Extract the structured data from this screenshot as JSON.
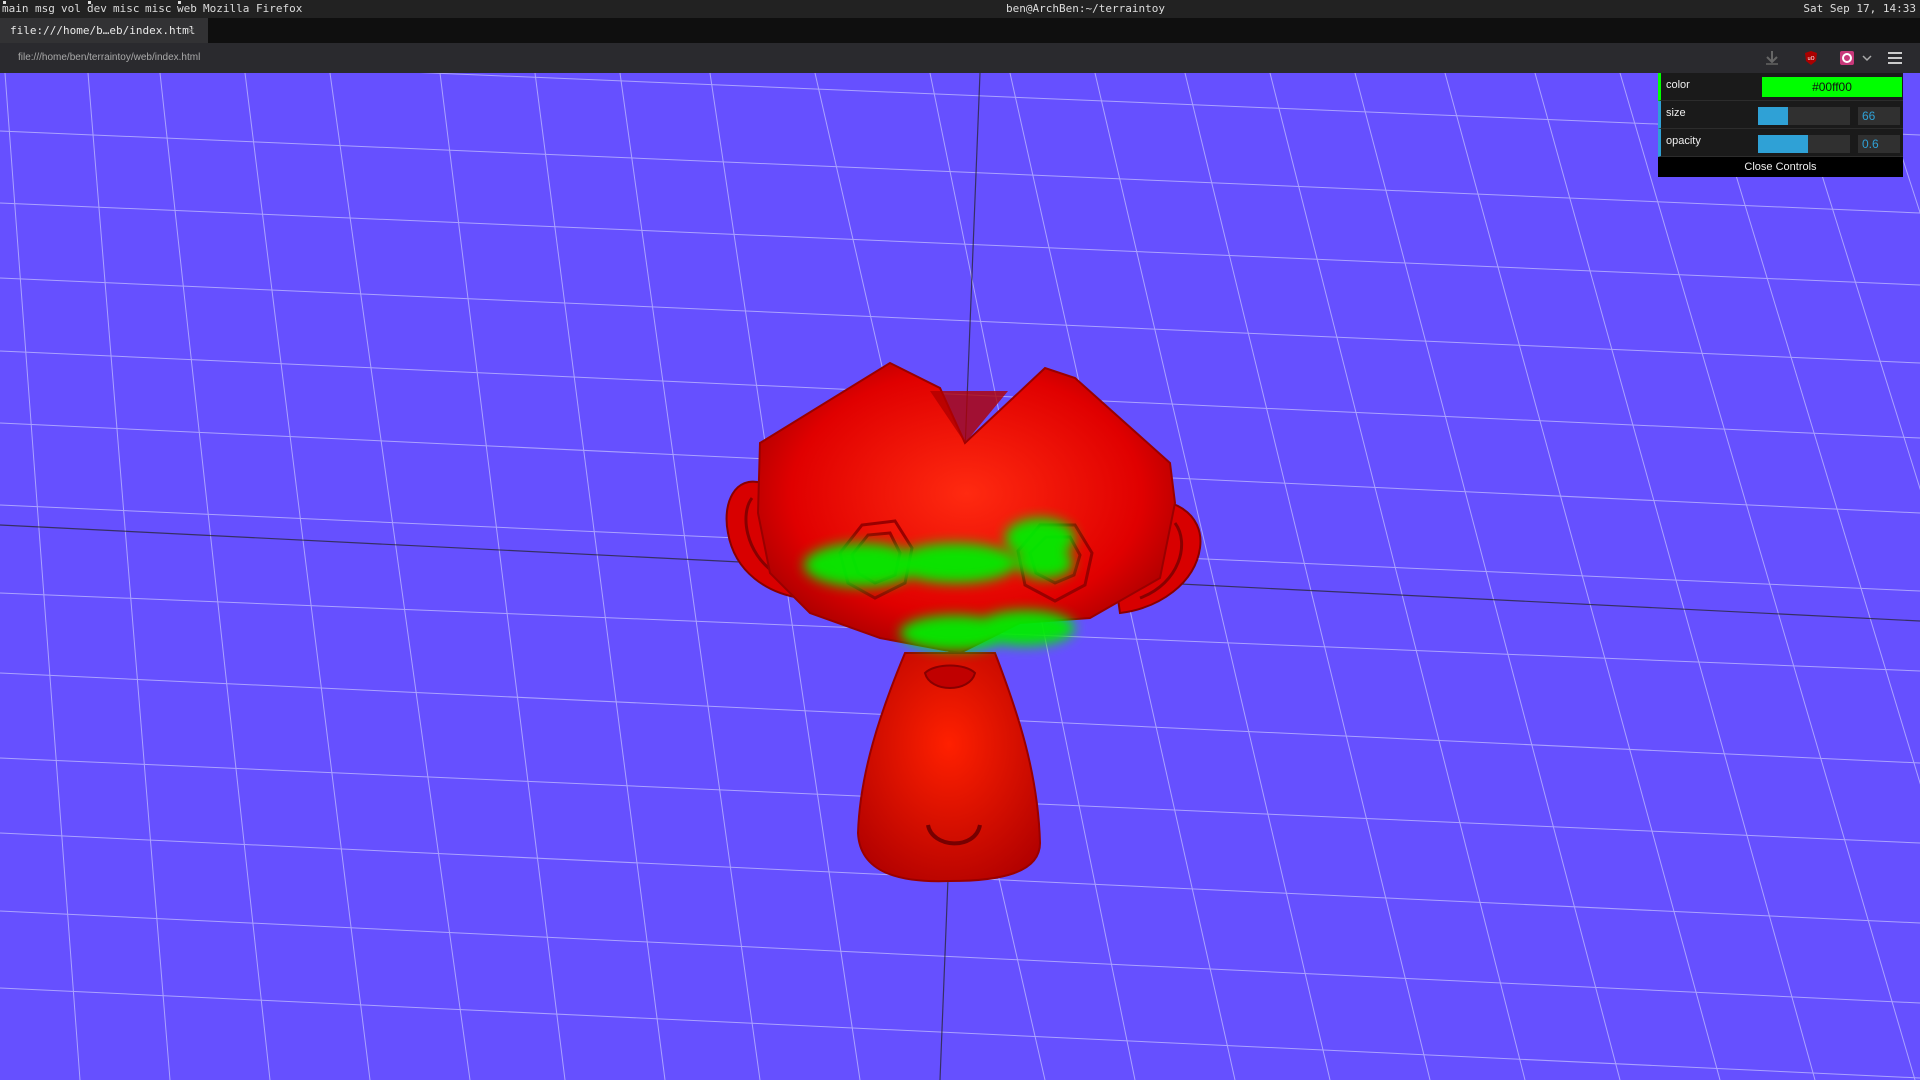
{
  "taskbar": {
    "workspaces": [
      "main",
      "msg",
      "vol",
      "dev",
      "misc",
      "misc",
      "web"
    ],
    "window_title": "Mozilla Firefox",
    "center_title": "ben@ArchBen:~/terraintoy",
    "clock": "Sat Sep 17, 14:33"
  },
  "browser": {
    "tab_title": "file:///home/b…eb/index.html",
    "tab_close": "×",
    "url": "file:///home/ben/terraintoy/web/index.html",
    "icons": [
      "download-icon",
      "ublock-icon",
      "extension-icon",
      "chevron-down-icon",
      "hamburger-menu-icon"
    ]
  },
  "scene": {
    "background_color": "#6650ff",
    "mesh_color": "#ff0000",
    "paint_color": "#00ff00",
    "grid_color": "#b0a8ff"
  },
  "controls": {
    "color_label": "color",
    "color_value": "#00ff00",
    "size_label": "size",
    "size_value": "66",
    "size_fraction": 0.33,
    "opacity_label": "opacity",
    "opacity_value": "0.6",
    "opacity_fraction": 0.54,
    "close_label": "Close Controls",
    "accent": "#2fa1d6"
  }
}
